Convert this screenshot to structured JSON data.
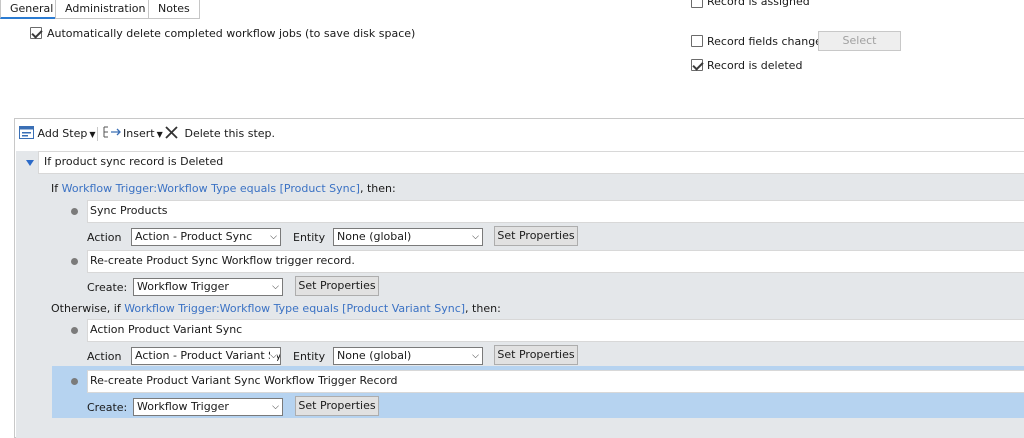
{
  "tabs": [
    {
      "label": "General",
      "active": true
    },
    {
      "label": "Administration",
      "active": false
    },
    {
      "label": "Notes",
      "active": false
    }
  ],
  "options": {
    "auto_delete_label": "Automatically delete completed workflow jobs (to save disk space)",
    "auto_delete_checked": true
  },
  "trigger_options": {
    "record_assigned": "Record is assigned",
    "record_fields_change": "Record fields change",
    "select_button": "Select",
    "record_deleted": "Record is deleted",
    "record_deleted_checked": true
  },
  "toolbar": {
    "add_step": "Add Step",
    "insert": "Insert",
    "delete_step": "Delete this step."
  },
  "workflow": {
    "header": "If product sync record is Deleted",
    "branch1": {
      "prefix": "If ",
      "condition": "Workflow Trigger:Workflow Type equals [Product Sync]",
      "suffix": ", then:",
      "step1": {
        "description": "Sync Products",
        "action_label": "Action",
        "action_value": "Action - Product Sync",
        "entity_label": "Entity",
        "entity_value": "None (global)",
        "set_properties": "Set Properties"
      },
      "step2": {
        "description": "Re-create Product Sync Workflow trigger record.",
        "create_label": "Create:",
        "create_value": "Workflow Trigger",
        "set_properties": "Set Properties"
      }
    },
    "branch2": {
      "prefix": "Otherwise, if ",
      "condition": "Workflow Trigger:Workflow Type equals [Product Variant Sync]",
      "suffix": ", then:",
      "step1": {
        "description": "Action Product Variant Sync",
        "action_label": "Action",
        "action_value": "Action - Product Variant Sy",
        "entity_label": "Entity",
        "entity_value": "None (global)",
        "set_properties": "Set Properties"
      },
      "step2": {
        "description": "Re-create Product Variant Sync Workflow Trigger Record",
        "create_label": "Create:",
        "create_value": "Workflow Trigger",
        "set_properties": "Set Properties",
        "selected": true
      }
    }
  },
  "colors": {
    "link": "#3b72c4",
    "selection": "#b6d3f0",
    "canvas": "#e4e7ea",
    "tab_active": "#2b7bd2"
  }
}
